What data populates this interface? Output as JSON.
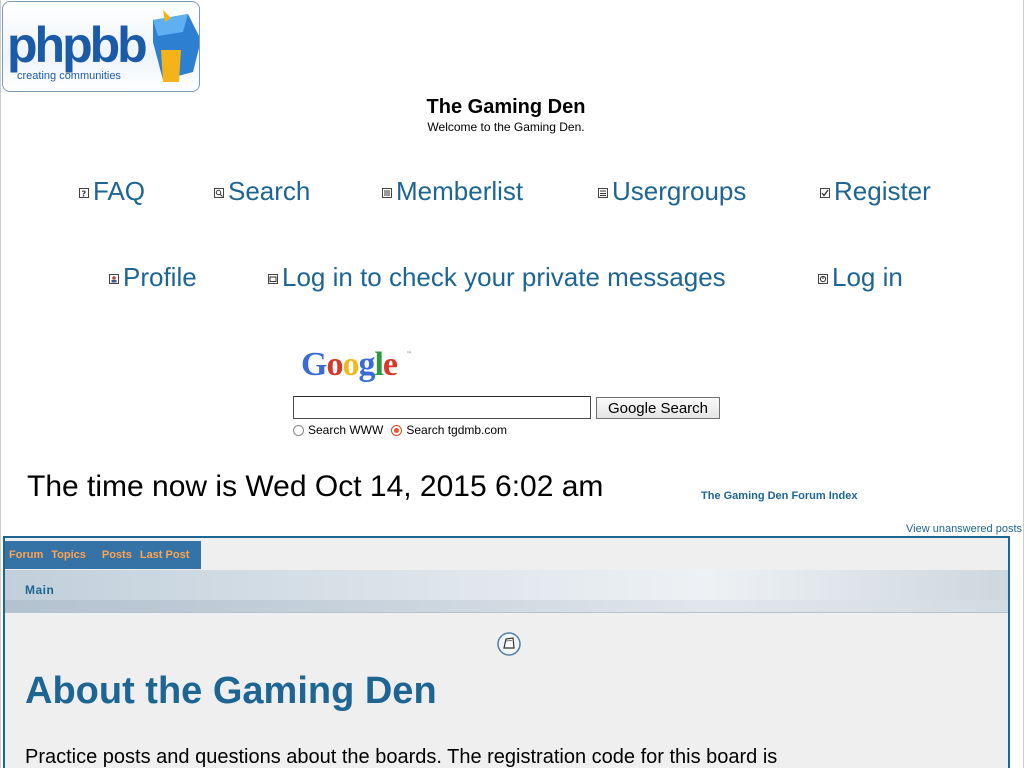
{
  "header": {
    "logo_main": "phpbb",
    "logo_tagline": "creating communities",
    "site_title": "The Gaming Den",
    "site_description": "Welcome to the Gaming Den."
  },
  "nav": {
    "faq": "FAQ",
    "search": "Search",
    "memberlist": "Memberlist",
    "usergroups": "Usergroups",
    "register": "Register",
    "profile": "Profile",
    "private_messages": "Log in to check your private messages",
    "login": "Log in"
  },
  "google_search": {
    "logo_text": "Google",
    "input_value": "",
    "button_label": "Google Search",
    "option_www": "Search WWW",
    "option_site": "Search tgdmb.com",
    "selected_option": "Search tgdmb.com"
  },
  "status": {
    "time_now": "The time now is Wed Oct 14, 2015 6:02 am",
    "forum_index_link": "The Gaming Den Forum Index",
    "unanswered_link": "View unanswered posts"
  },
  "forum_table": {
    "columns": [
      "Forum",
      "Topics",
      "Posts",
      "Last Post"
    ],
    "category": "Main",
    "forums": [
      {
        "name": "About the Gaming Den",
        "description": "Practice posts and questions about the boards. The registration code for this board is"
      }
    ]
  },
  "colors": {
    "link": "#1d6593",
    "header_bg": "#3573a6",
    "header_text": "#ffa34f"
  },
  "icons": {
    "faq": "faq-icon",
    "search": "search-icon",
    "memberlist": "memberlist-icon",
    "usergroups": "usergroups-icon",
    "register": "register-icon",
    "profile": "profile-icon",
    "private_messages": "message-icon",
    "login": "login-icon",
    "forum_status": "forum-folder-icon"
  }
}
